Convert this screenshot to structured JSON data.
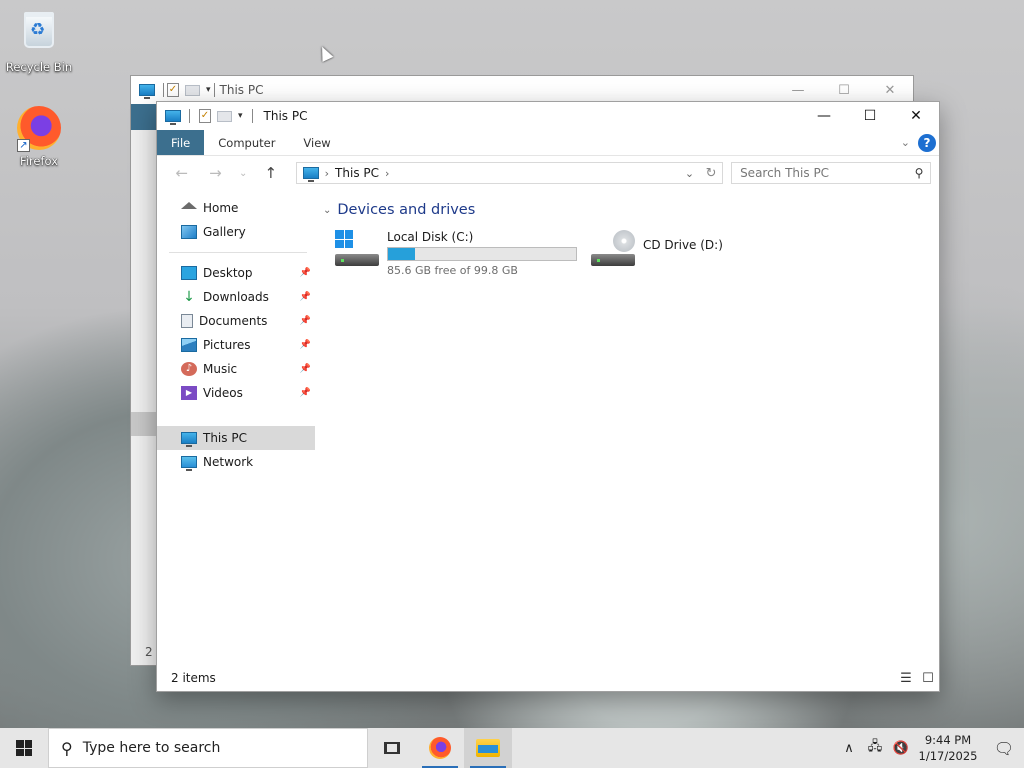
{
  "desktop": {
    "icons": [
      {
        "label": "Recycle Bin",
        "icon": "recycle-bin-icon"
      },
      {
        "label": "Firefox",
        "icon": "firefox-icon"
      }
    ]
  },
  "back_window": {
    "title": "This PC",
    "status": "2 i"
  },
  "window": {
    "title": "This PC",
    "ribbon_tabs": [
      "File",
      "Computer",
      "View"
    ],
    "address": {
      "segment": "This PC"
    },
    "search_placeholder": "Search This PC",
    "nav": {
      "quick": [
        {
          "label": "Home",
          "icon": "home-icon"
        },
        {
          "label": "Gallery",
          "icon": "gallery-icon"
        }
      ],
      "pinned": [
        {
          "label": "Desktop",
          "icon": "desktop-icon"
        },
        {
          "label": "Downloads",
          "icon": "downloads-icon"
        },
        {
          "label": "Documents",
          "icon": "documents-icon"
        },
        {
          "label": "Pictures",
          "icon": "pictures-icon"
        },
        {
          "label": "Music",
          "icon": "music-icon"
        },
        {
          "label": "Videos",
          "icon": "videos-icon"
        }
      ],
      "locations": [
        {
          "label": "This PC",
          "icon": "this-pc-icon",
          "selected": true
        },
        {
          "label": "Network",
          "icon": "network-icon"
        }
      ]
    },
    "group_title": "Devices and drives",
    "drives": [
      {
        "name": "Local Disk (C:)",
        "free_text": "85.6 GB free of 99.8 GB",
        "used_fraction": 0.142
      },
      {
        "name": "CD Drive (D:)"
      }
    ],
    "status": "2 items"
  },
  "taskbar": {
    "search_placeholder": "Type here to search",
    "time": "9:44 PM",
    "date": "1/17/2025"
  },
  "colors": {
    "accent": "#3c6f8e",
    "progress": "#26a0da",
    "link_blue": "#1e3a8a"
  }
}
